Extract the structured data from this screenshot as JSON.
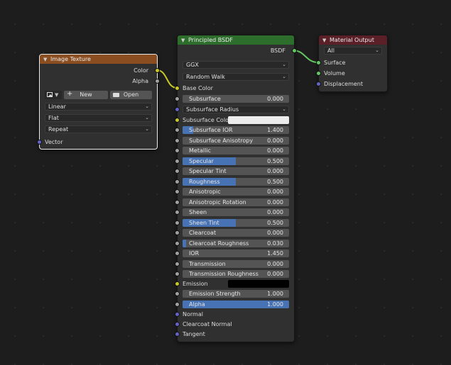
{
  "image_texture": {
    "title": "Image Texture",
    "outputs": {
      "color": "Color",
      "alpha": "Alpha"
    },
    "new_label": "New",
    "open_label": "Open",
    "interpolation": "Linear",
    "projection": "Flat",
    "extension": "Repeat",
    "vector": "Vector"
  },
  "principled": {
    "title": "Principled BSDF",
    "output": "BSDF",
    "distribution": "GGX",
    "subsurface_method": "Random Walk",
    "base_color": "Base Color",
    "subsurface": {
      "label": "Subsurface",
      "value": "0.000"
    },
    "subsurface_radius": "Subsurface Radius",
    "subsurface_color": "Subsurface Color",
    "fields": [
      {
        "label": "Subsurface IOR",
        "value": "1.400",
        "fill": 0.1
      },
      {
        "label": "Subsurface Anisotropy",
        "value": "0.000",
        "fill": 0
      },
      {
        "label": "Metallic",
        "value": "0.000",
        "fill": 0
      },
      {
        "label": "Specular",
        "value": "0.500",
        "fill": 0.5
      },
      {
        "label": "Specular Tint",
        "value": "0.000",
        "fill": 0
      },
      {
        "label": "Roughness",
        "value": "0.500",
        "fill": 0.5
      },
      {
        "label": "Anisotropic",
        "value": "0.000",
        "fill": 0
      },
      {
        "label": "Anisotropic Rotation",
        "value": "0.000",
        "fill": 0
      },
      {
        "label": "Sheen",
        "value": "0.000",
        "fill": 0
      },
      {
        "label": "Sheen Tint",
        "value": "0.500",
        "fill": 0.5
      },
      {
        "label": "Clearcoat",
        "value": "0.000",
        "fill": 0
      },
      {
        "label": "Clearcoat Roughness",
        "value": "0.030",
        "fill": 0.03
      },
      {
        "label": "IOR",
        "value": "1.450",
        "fill": 0
      },
      {
        "label": "Transmission",
        "value": "0.000",
        "fill": 0
      },
      {
        "label": "Transmission Roughness",
        "value": "0.000",
        "fill": 0
      }
    ],
    "emission": "Emission",
    "emission_strength": {
      "label": "Emission Strength",
      "value": "1.000",
      "fill": 0
    },
    "alpha": {
      "label": "Alpha",
      "value": "1.000",
      "fill": 1
    },
    "normal": "Normal",
    "clearcoat_normal": "Clearcoat Normal",
    "tangent": "Tangent"
  },
  "material_output": {
    "title": "Material Output",
    "target": "All",
    "surface": "Surface",
    "volume": "Volume",
    "displacement": "Displacement"
  },
  "colors": {
    "texture_header": "#8a4d1f",
    "shader_header": "#2e6e2c",
    "output_header": "#5a1f27",
    "color_socket": "#c7c729",
    "float_socket": "#a1a1a1",
    "vector_socket": "#6363c7",
    "shader_socket": "#63c763",
    "slider_fill": "#4772b3",
    "subsurface_color": "#ececec",
    "emission_color": "#000000"
  }
}
